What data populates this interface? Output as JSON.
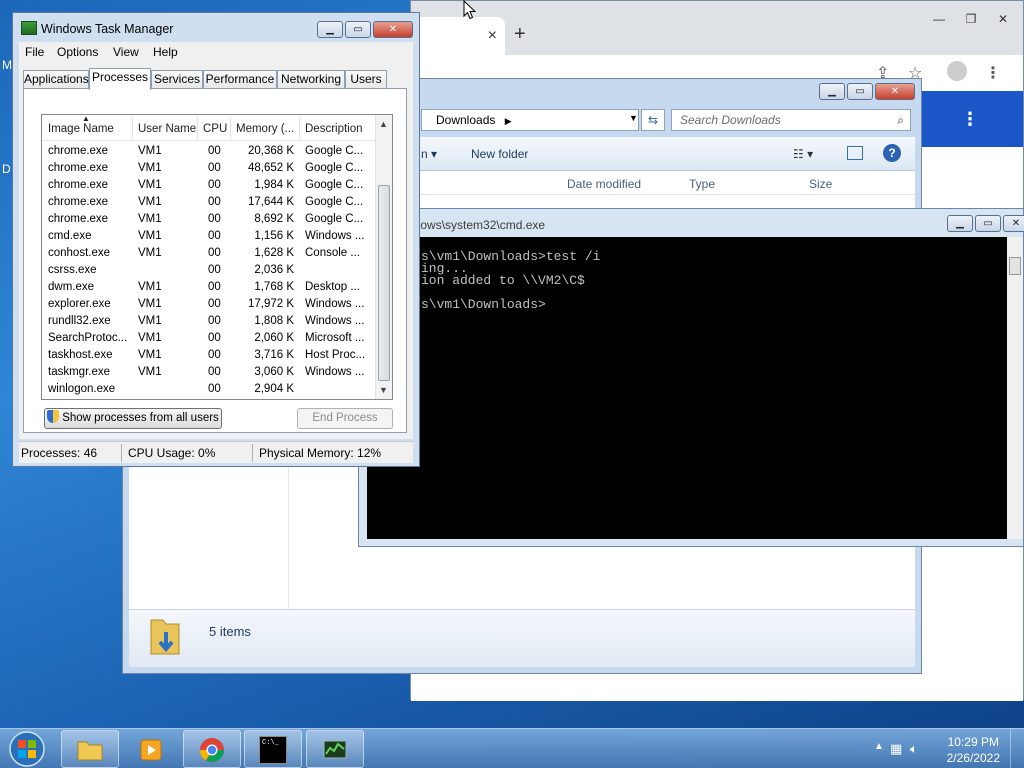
{
  "desktop": {
    "edge_text_1": "M",
    "edge_text_2": "D"
  },
  "chrome": {
    "winbtn_min": "—",
    "winbtn_max": "❐",
    "winbtn_close": "✕",
    "new_tab": "+",
    "tab_close": "×"
  },
  "explorer": {
    "address": "Downloads",
    "search_placeholder": "Search Downloads",
    "new_folder": "New folder",
    "cmdbar_partial": "n",
    "columns": {
      "date_modified": "Date modified",
      "type": "Type",
      "size": "Size"
    },
    "items_count": "5 items"
  },
  "cmd": {
    "title": "ndows\\system32\\cmd.exe",
    "lines": [
      "s\\vm1\\Downloads>test /i",
      "ing...",
      "ion added to \\\\VM2\\C$",
      "",
      "s\\vm1\\Downloads>"
    ]
  },
  "taskmgr": {
    "title": "Windows Task Manager",
    "menu": [
      "File",
      "Options",
      "View",
      "Help"
    ],
    "tabs": [
      "Applications",
      "Processes",
      "Services",
      "Performance",
      "Networking",
      "Users"
    ],
    "active_tab": "Processes",
    "columns": [
      "Image Name",
      "User Name",
      "CPU",
      "Memory (...",
      "Description"
    ],
    "rows": [
      [
        "chrome.exe",
        "VM1",
        "00",
        "20,368 K",
        "Google C..."
      ],
      [
        "chrome.exe",
        "VM1",
        "00",
        "48,652 K",
        "Google C..."
      ],
      [
        "chrome.exe",
        "VM1",
        "00",
        "1,984 K",
        "Google C..."
      ],
      [
        "chrome.exe",
        "VM1",
        "00",
        "17,644 K",
        "Google C..."
      ],
      [
        "chrome.exe",
        "VM1",
        "00",
        "8,692 K",
        "Google C..."
      ],
      [
        "cmd.exe",
        "VM1",
        "00",
        "1,156 K",
        "Windows ..."
      ],
      [
        "conhost.exe",
        "VM1",
        "00",
        "1,628 K",
        "Console ..."
      ],
      [
        "csrss.exe",
        "",
        "00",
        "2,036 K",
        ""
      ],
      [
        "dwm.exe",
        "VM1",
        "00",
        "1,768 K",
        "Desktop ..."
      ],
      [
        "explorer.exe",
        "VM1",
        "00",
        "17,972 K",
        "Windows ..."
      ],
      [
        "rundll32.exe",
        "VM1",
        "00",
        "1,808 K",
        "Windows ..."
      ],
      [
        "SearchProtoc...",
        "VM1",
        "00",
        "2,060 K",
        "Microsoft ..."
      ],
      [
        "taskhost.exe",
        "VM1",
        "00",
        "3,716 K",
        "Host Proc..."
      ],
      [
        "taskmgr.exe",
        "VM1",
        "00",
        "3,060 K",
        "Windows ..."
      ],
      [
        "winlogon.exe",
        "",
        "00",
        "2,904 K",
        ""
      ]
    ],
    "show_all_button": "Show processes from all users",
    "end_process_button": "End Process",
    "status": {
      "processes": "Processes: 46",
      "cpu": "CPU Usage: 0%",
      "memory": "Physical Memory: 12%"
    }
  },
  "taskbar": {
    "time": "10:29 PM",
    "date": "2/26/2022",
    "cmd_icon_text": "C:\\_"
  }
}
